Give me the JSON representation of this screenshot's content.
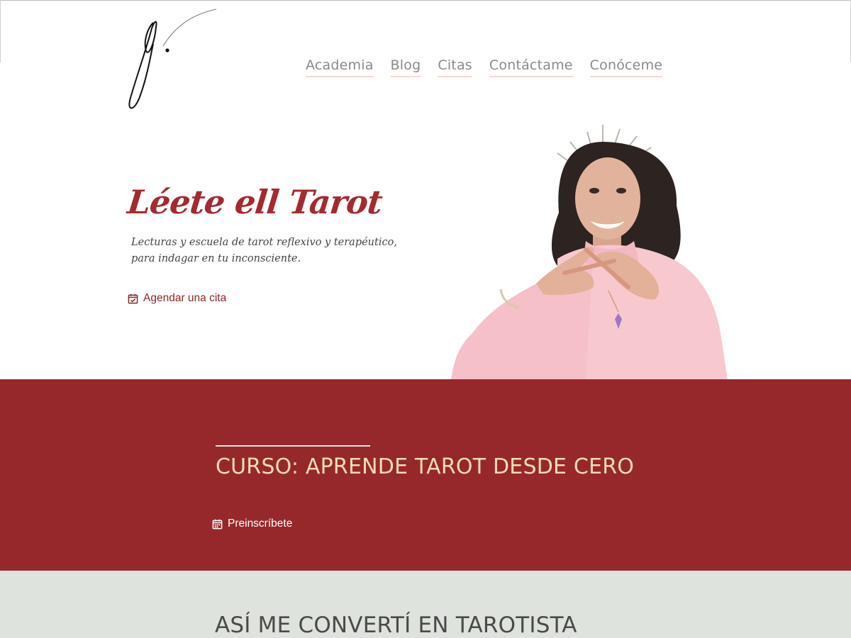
{
  "nav": {
    "items": [
      {
        "label": "Academia"
      },
      {
        "label": "Blog"
      },
      {
        "label": "Citas"
      },
      {
        "label": "Contáctame"
      },
      {
        "label": "Conóceme"
      }
    ]
  },
  "hero": {
    "title": "Léete ell Tarot",
    "subtitle": "Lecturas y escuela de tarot reflexivo y terapéutico, para indagar en tu inconsciente.",
    "cta": {
      "label": "Agendar una cita",
      "icon": "calendar-check-icon"
    }
  },
  "course": {
    "title": "CURSO: APRENDE TAROT DESDE CERO",
    "cta": {
      "label": "Preinscríbete",
      "icon": "calendar-icon"
    }
  },
  "about": {
    "title": "ASÍ ME CONVERTÍ EN TAROTISTA"
  },
  "colors": {
    "brand_red": "#96282b",
    "title_red": "#a52a2f",
    "course_title": "#f6dcb8",
    "nav_text": "#8a8a8a",
    "nav_underline": "#f7d8cf",
    "grey_band": "#dfe3dd"
  }
}
